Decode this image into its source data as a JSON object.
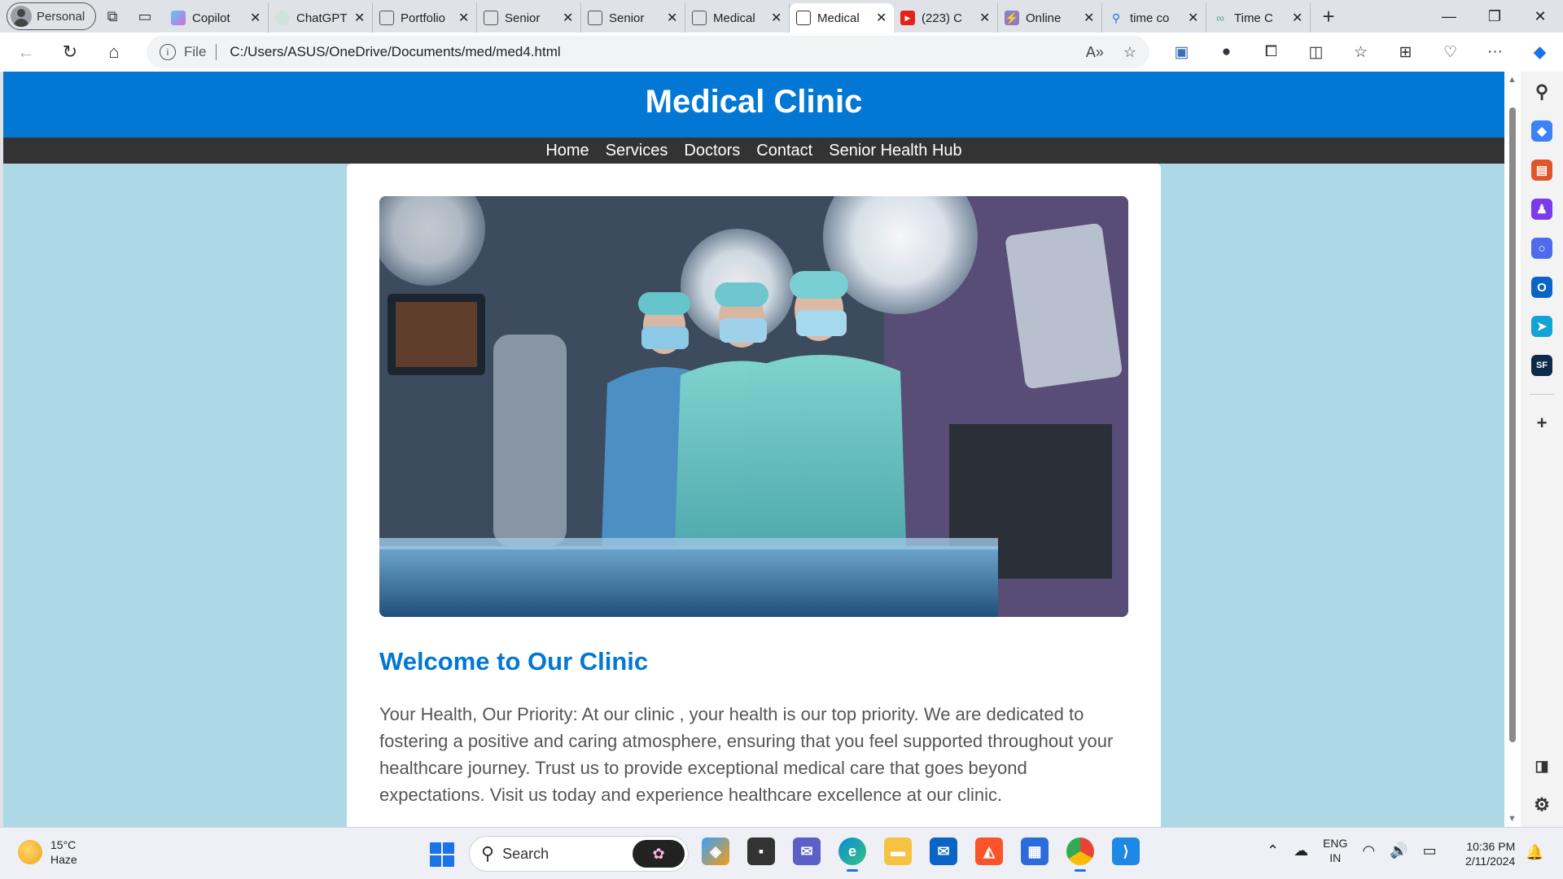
{
  "browser": {
    "profile_label": "Personal",
    "tabs": [
      {
        "title": "Copilot",
        "icon": "copilot-icon",
        "active": false
      },
      {
        "title": "ChatGPT",
        "icon": "chatgpt-icon",
        "active": false
      },
      {
        "title": "Portfolio",
        "icon": "document-icon",
        "active": false
      },
      {
        "title": "Senior",
        "icon": "document-icon",
        "active": false
      },
      {
        "title": "Senior",
        "icon": "document-icon",
        "active": false
      },
      {
        "title": "Medical",
        "icon": "document-icon",
        "active": false
      },
      {
        "title": "Medical",
        "icon": "document-icon",
        "active": true
      },
      {
        "title": "(223) C",
        "icon": "youtube-icon",
        "active": false
      },
      {
        "title": "Online",
        "icon": "bolt-icon",
        "active": false
      },
      {
        "title": "time co",
        "icon": "search-icon",
        "active": false
      },
      {
        "title": "Time C",
        "icon": "link-icon",
        "active": false
      }
    ],
    "address": {
      "scheme_label": "File",
      "url": "C:/Users/ASUS/OneDrive/Documents/med/med4.html"
    }
  },
  "site": {
    "title": "Medical Clinic",
    "nav": [
      "Home",
      "Services",
      "Doctors",
      "Contact",
      "Senior Health Hub"
    ],
    "welcome_heading": "Welcome to Our Clinic",
    "intro_text": "Your Health, Our Priority: At our clinic , your health is our top priority. We are dedicated to fostering a positive and caring atmosphere, ensuring that you feel supported throughout your healthcare journey. Trust us to provide exceptional medical care that goes beyond expectations. Visit us today and experience healthcare excellence at our clinic.",
    "colors": {
      "brand_blue": "#0277d4",
      "nav_bg": "#333333",
      "page_bg": "#add8e6"
    }
  },
  "taskbar": {
    "weather": {
      "temp": "15°C",
      "condition": "Haze"
    },
    "search_placeholder": "Search",
    "language": {
      "lang": "ENG",
      "region": "IN"
    },
    "time": "10:36 PM",
    "date": "2/11/2024"
  }
}
